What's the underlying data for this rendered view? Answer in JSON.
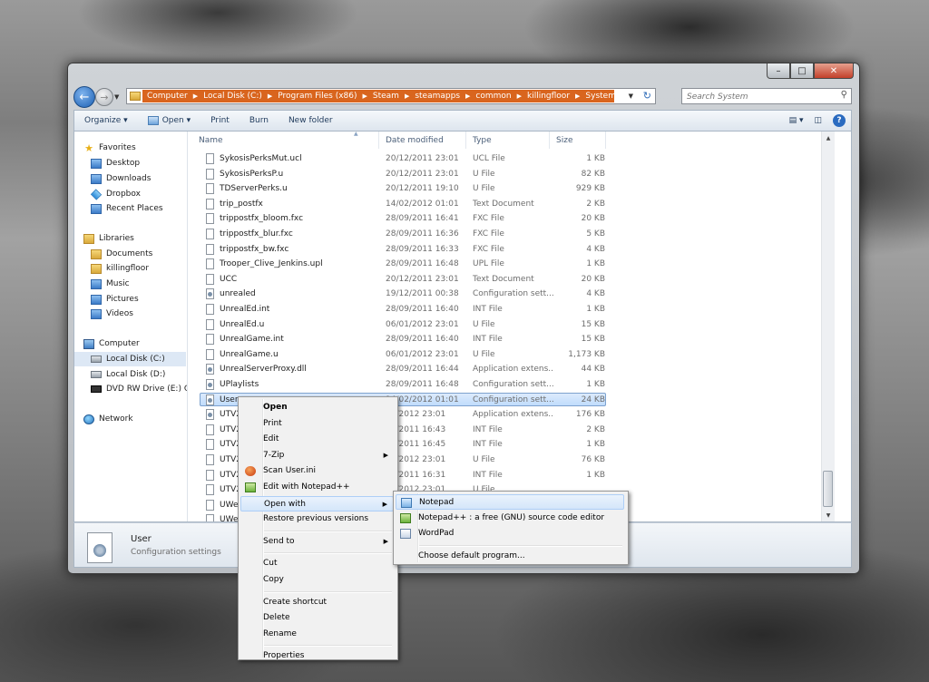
{
  "window": {
    "caption": {
      "min": "–",
      "max": "□",
      "close": "✕"
    },
    "address": {
      "crumbs": [
        "Computer",
        "Local Disk (C:)",
        "Program Files (x86)",
        "Steam",
        "steamapps",
        "common",
        "killingfloor",
        "System"
      ]
    },
    "search": {
      "placeholder": "Search System"
    },
    "toolbar": {
      "organize": "Organize ▾",
      "open": "Open ▾",
      "print": "Print",
      "burn": "Burn",
      "new_folder": "New folder",
      "views": "▤ ▾",
      "help": "?"
    },
    "nav": [
      {
        "label": "Favorites",
        "icon": "star-icon"
      },
      {
        "label": "Desktop",
        "icon": "desktop-icon"
      },
      {
        "label": "Downloads",
        "icon": "downloads-icon"
      },
      {
        "label": "Dropbox",
        "icon": "dropbox-icon"
      },
      {
        "label": "Recent Places",
        "icon": "recent-places-icon"
      },
      {
        "label": "Libraries",
        "icon": "libraries-icon"
      },
      {
        "label": "Documents",
        "icon": "documents-icon"
      },
      {
        "label": "killingfloor",
        "icon": "folder-icon"
      },
      {
        "label": "Music",
        "icon": "music-icon"
      },
      {
        "label": "Pictures",
        "icon": "pictures-icon"
      },
      {
        "label": "Videos",
        "icon": "videos-icon"
      },
      {
        "label": "Computer",
        "icon": "computer-icon"
      },
      {
        "label": "Local Disk (C:)",
        "icon": "drive-icon"
      },
      {
        "label": "Local Disk (D:)",
        "icon": "drive-icon"
      },
      {
        "label": "DVD RW Drive (E:) G",
        "icon": "dvd-icon"
      },
      {
        "label": "Network",
        "icon": "network-icon"
      }
    ],
    "columns": {
      "name": "Name",
      "date": "Date modified",
      "type": "Type",
      "size": "Size"
    },
    "files": [
      {
        "name": "SykosisPerksMut.ucl",
        "date": "20/12/2011 23:01",
        "type": "UCL File",
        "size": "1 KB"
      },
      {
        "name": "SykosisPerksP.u",
        "date": "20/12/2011 23:01",
        "type": "U File",
        "size": "82 KB"
      },
      {
        "name": "TDServerPerks.u",
        "date": "20/12/2011 19:10",
        "type": "U File",
        "size": "929 KB"
      },
      {
        "name": "trip_postfx",
        "date": "14/02/2012 01:01",
        "type": "Text Document",
        "size": "2 KB"
      },
      {
        "name": "trippostfx_bloom.fxc",
        "date": "28/09/2011 16:41",
        "type": "FXC File",
        "size": "20 KB"
      },
      {
        "name": "trippostfx_blur.fxc",
        "date": "28/09/2011 16:36",
        "type": "FXC File",
        "size": "5 KB"
      },
      {
        "name": "trippostfx_bw.fxc",
        "date": "28/09/2011 16:33",
        "type": "FXC File",
        "size": "4 KB"
      },
      {
        "name": "Trooper_Clive_Jenkins.upl",
        "date": "28/09/2011 16:48",
        "type": "UPL File",
        "size": "1 KB"
      },
      {
        "name": "UCC",
        "date": "20/12/2011 23:01",
        "type": "Text Document",
        "size": "20 KB"
      },
      {
        "name": "unrealed",
        "date": "19/12/2011 00:38",
        "type": "Configuration sett...",
        "size": "4 KB"
      },
      {
        "name": "UnrealEd.int",
        "date": "28/09/2011 16:40",
        "type": "INT File",
        "size": "1 KB"
      },
      {
        "name": "UnrealEd.u",
        "date": "06/01/2012 23:01",
        "type": "U File",
        "size": "15 KB"
      },
      {
        "name": "UnrealGame.int",
        "date": "28/09/2011 16:40",
        "type": "INT File",
        "size": "15 KB"
      },
      {
        "name": "UnrealGame.u",
        "date": "06/01/2012 23:01",
        "type": "U File",
        "size": "1,173 KB"
      },
      {
        "name": "UnrealServerProxy.dll",
        "date": "28/09/2011 16:44",
        "type": "Application extens...",
        "size": "44 KB"
      },
      {
        "name": "UPlaylists",
        "date": "28/09/2011 16:48",
        "type": "Configuration sett...",
        "size": "1 KB"
      },
      {
        "name": "User",
        "date": "14/02/2012 01:01",
        "type": "Configuration sett...",
        "size": "24 KB"
      },
      {
        "name": "UTV20",
        "date": "01/2012 23:01",
        "type": "Application extens...",
        "size": "176 KB"
      },
      {
        "name": "UTV20",
        "date": "09/2011 16:43",
        "type": "INT File",
        "size": "2 KB"
      },
      {
        "name": "UTV20",
        "date": "09/2011 16:45",
        "type": "INT File",
        "size": "1 KB"
      },
      {
        "name": "UTV20",
        "date": "01/2012 23:01",
        "type": "U File",
        "size": "76 KB"
      },
      {
        "name": "UTV20",
        "date": "09/2011 16:31",
        "type": "INT File",
        "size": "1 KB"
      },
      {
        "name": "UTV20",
        "date": "01/2012 23:01",
        "type": "U File",
        "size": ""
      },
      {
        "name": "UWeb",
        "date": "",
        "type": "",
        "size": ""
      },
      {
        "name": "UWeb",
        "date": "",
        "type": "",
        "size": ""
      }
    ],
    "details": {
      "name": "User",
      "type": "Configuration settings"
    }
  },
  "context_menu": [
    {
      "label": "Open",
      "bold": true
    },
    {
      "label": "Print"
    },
    {
      "label": "Edit"
    },
    {
      "label": "7-Zip",
      "submenu": true
    },
    {
      "label": "Scan User.ini",
      "icon": "scan-icon"
    },
    {
      "label": "Edit with Notepad++",
      "icon": "notepadpp-icon"
    },
    {
      "label": "Open with",
      "submenu": true,
      "highlighted": true
    },
    {
      "label": "Restore previous versions"
    },
    {
      "sep": true
    },
    {
      "label": "Send to",
      "submenu": true
    },
    {
      "sep": true
    },
    {
      "label": "Cut"
    },
    {
      "label": "Copy"
    },
    {
      "sep": true
    },
    {
      "label": "Create shortcut"
    },
    {
      "label": "Delete"
    },
    {
      "label": "Rename"
    },
    {
      "sep": true
    },
    {
      "label": "Properties"
    }
  ],
  "open_with_menu": [
    {
      "label": "Notepad",
      "icon": "notepad-icon",
      "highlighted": true
    },
    {
      "label": "Notepad++ : a free (GNU) source code editor",
      "icon": "notepadpp-icon"
    },
    {
      "label": "WordPad",
      "icon": "wordpad-icon"
    },
    {
      "sep": true
    },
    {
      "label": "Choose default program..."
    }
  ],
  "submenu_arrow": "▶"
}
